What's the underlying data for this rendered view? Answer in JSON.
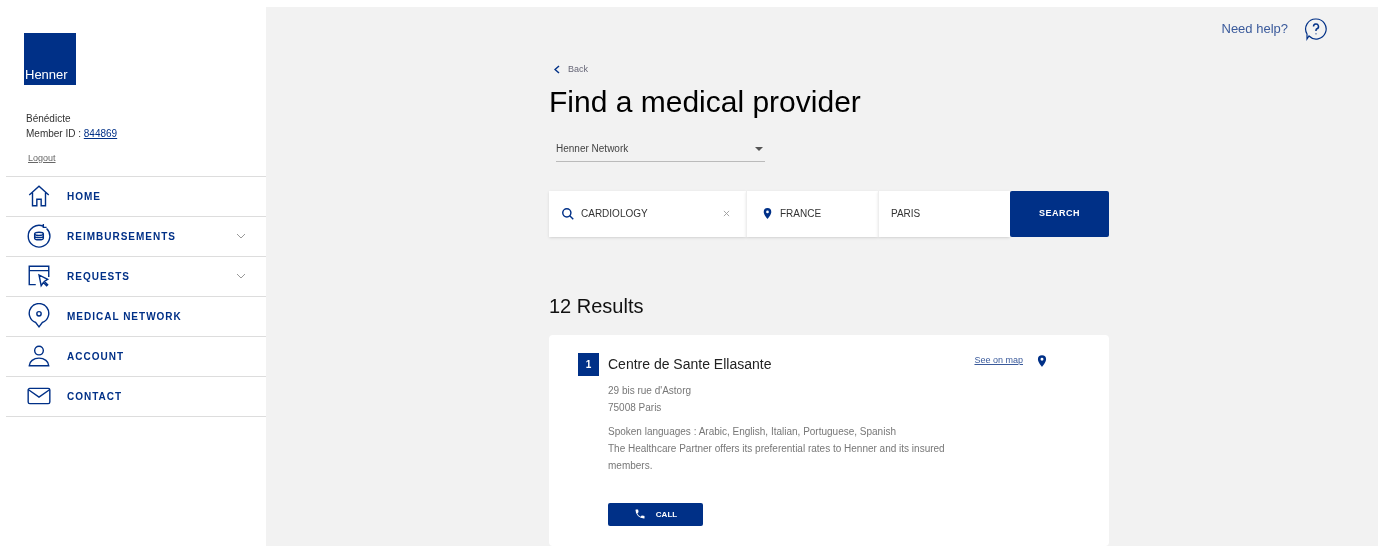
{
  "logo": "Henner",
  "user": {
    "name": "Bénédicte",
    "member_label": "Member ID : ",
    "member_id": "844869",
    "logout": "Logout"
  },
  "nav": [
    {
      "label": "HOME",
      "kind": "home",
      "expandable": false
    },
    {
      "label": "REIMBURSEMENTS",
      "kind": "coins",
      "expandable": true
    },
    {
      "label": "REQUESTS",
      "kind": "cursor",
      "expandable": true
    },
    {
      "label": "MEDICAL NETWORK",
      "kind": "pin",
      "expandable": false
    },
    {
      "label": "ACCOUNT",
      "kind": "user",
      "expandable": false
    },
    {
      "label": "CONTACT",
      "kind": "mail",
      "expandable": false
    }
  ],
  "help": "Need help?",
  "back": "Back",
  "title": "Find a medical provider",
  "network_select": {
    "value": "Henner Network"
  },
  "search": {
    "specialty": "CARDIOLOGY",
    "country": "FRANCE",
    "city": "PARIS",
    "button": "SEARCH"
  },
  "results_title": "12 Results",
  "results": [
    {
      "number": "1",
      "name": "Centre de Sante Ellasante",
      "map_link": "See on map",
      "address": [
        "29 bis rue d'Astorg",
        "75008 Paris"
      ],
      "languages": "Spoken languages : Arabic, English, Italian, Portuguese, Spanish",
      "note": "The Healthcare Partner offers its preferential rates to Henner and its insured members.",
      "call": "CALL"
    }
  ]
}
